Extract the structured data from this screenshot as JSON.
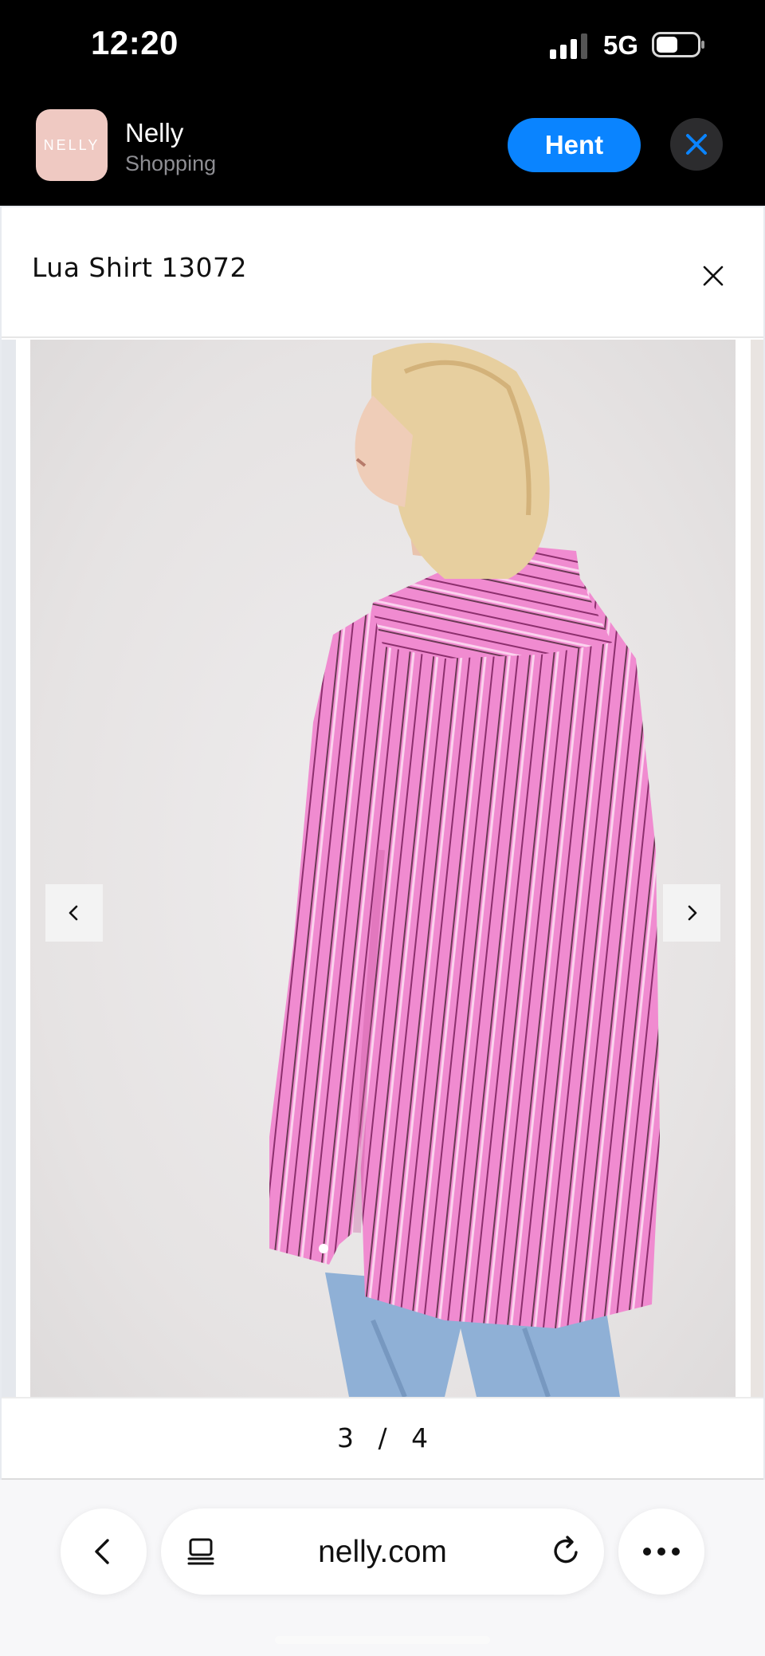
{
  "status_bar": {
    "time": "12:20",
    "network": "5G"
  },
  "app_banner": {
    "icon_text": "NELLY",
    "app_name": "Nelly",
    "app_subtitle": "Shopping",
    "get_button": "Hent",
    "accent_color": "#0a84ff"
  },
  "product_modal": {
    "title": "Lua Shirt 13072",
    "gallery": {
      "current_page": "3",
      "separator": "/",
      "total_pages": "4"
    }
  },
  "browser": {
    "url": "nelly.com"
  }
}
